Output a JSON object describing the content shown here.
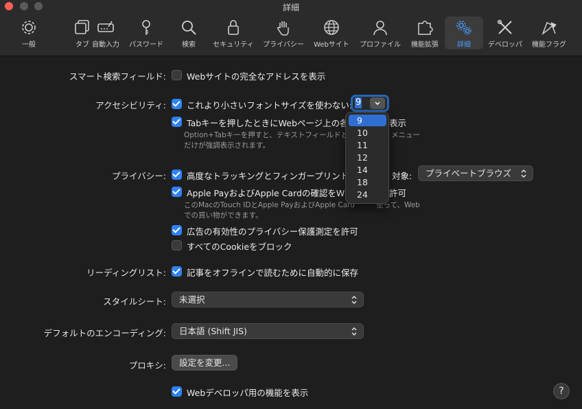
{
  "window": {
    "title": "詳細"
  },
  "toolbar": {
    "items": [
      {
        "label": "一般",
        "icon": "gear-icon"
      },
      {
        "label": "タブ",
        "icon": "tabs-icon"
      },
      {
        "label": "自動入力",
        "icon": "autofill-icon"
      },
      {
        "label": "パスワード",
        "icon": "key-icon"
      },
      {
        "label": "検索",
        "icon": "search-icon"
      },
      {
        "label": "セキュリティ",
        "icon": "lock-icon"
      },
      {
        "label": "プライバシー",
        "icon": "hand-icon"
      },
      {
        "label": "Webサイト",
        "icon": "globe-icon"
      },
      {
        "label": "プロファイル",
        "icon": "person-icon"
      },
      {
        "label": "機能拡張",
        "icon": "puzzle-icon"
      },
      {
        "label": "詳細",
        "icon": "gears-icon",
        "active": true
      },
      {
        "label": "デベロッパ",
        "icon": "tools-icon"
      },
      {
        "label": "機能フラグ",
        "icon": "flags-icon"
      }
    ]
  },
  "smart_search": {
    "label": "スマート検索フィールド:",
    "full_address": {
      "label": "Webサイトの完全なアドレスを表示",
      "checked": false
    }
  },
  "accessibility": {
    "label": "アクセシビリティ:",
    "min_font": {
      "label": "これより小さいフォントサイズを使わない:",
      "checked": true,
      "value": "9"
    },
    "tab_highlight": {
      "label": "Tabキーを押したときにWebページ上の各",
      "label_tail": "表示",
      "checked": true
    },
    "note_line1": "Option+Tabキーを押すと、テキストフィールドと",
    "note_line1_tail": "メニュー",
    "note_line2": "だけが強調表示されます。"
  },
  "font_dropdown": {
    "options": [
      "9",
      "10",
      "11",
      "12",
      "14",
      "18",
      "24"
    ],
    "selected": "9"
  },
  "privacy": {
    "label": "プライバシー:",
    "tracking": {
      "label": "高度なトラッキングとフィンガープリント",
      "checked": true
    },
    "target_label": "対象:",
    "target_value": "プライベートブラウズ",
    "apple_pay": {
      "label": "Apple PayおよびApple Cardの確認をW",
      "label_tail": "許可",
      "checked": true
    },
    "apple_pay_note_line1": "このMacのTouch IDとApple PayおよびApple Card",
    "apple_pay_note_line1_tail": "使って、Web",
    "apple_pay_note_line2": "での買い物ができます。",
    "ad_measure": {
      "label": "広告の有効性のプライバシー保護測定を許可",
      "checked": true
    },
    "block_cookies": {
      "label": "すべてのCookieをブロック",
      "checked": false
    }
  },
  "reading_list": {
    "label": "リーディングリスト:",
    "offline": {
      "label": "記事をオフラインで読むために自動的に保存",
      "checked": true
    }
  },
  "stylesheet": {
    "label": "スタイルシート:",
    "value": "未選択"
  },
  "encoding": {
    "label": "デフォルトのエンコーディング:",
    "value": "日本語 (Shift JIS)"
  },
  "proxy": {
    "label": "プロキシ:",
    "button": "設定を変更..."
  },
  "developer": {
    "label": "Webデベロッパ用の機能を表示",
    "checked": true
  },
  "help": {
    "label": "?"
  },
  "colors": {
    "accent": "#2f82f5",
    "background": "#1e1e1e",
    "close": "#ff5f57"
  }
}
